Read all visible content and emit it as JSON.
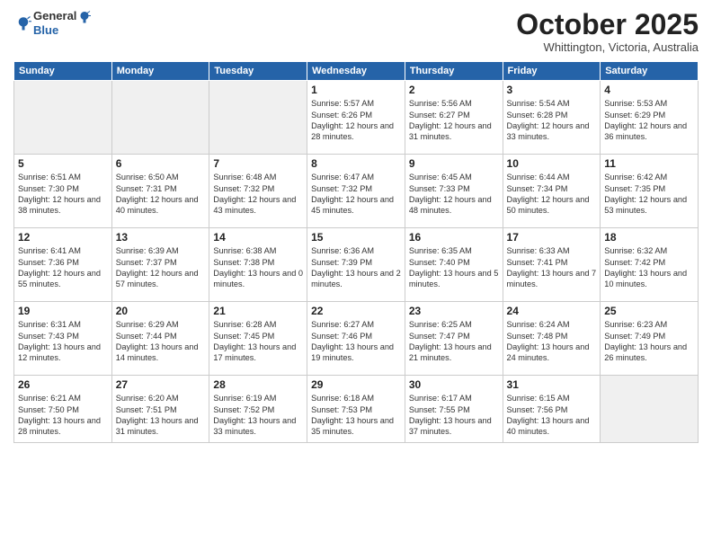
{
  "header": {
    "logo_general": "General",
    "logo_blue": "Blue",
    "month_title": "October 2025",
    "subtitle": "Whittington, Victoria, Australia"
  },
  "days_of_week": [
    "Sunday",
    "Monday",
    "Tuesday",
    "Wednesday",
    "Thursday",
    "Friday",
    "Saturday"
  ],
  "weeks": [
    [
      {
        "day": "",
        "info": ""
      },
      {
        "day": "",
        "info": ""
      },
      {
        "day": "",
        "info": ""
      },
      {
        "day": "1",
        "info": "Sunrise: 5:57 AM\nSunset: 6:26 PM\nDaylight: 12 hours\nand 28 minutes."
      },
      {
        "day": "2",
        "info": "Sunrise: 5:56 AM\nSunset: 6:27 PM\nDaylight: 12 hours\nand 31 minutes."
      },
      {
        "day": "3",
        "info": "Sunrise: 5:54 AM\nSunset: 6:28 PM\nDaylight: 12 hours\nand 33 minutes."
      },
      {
        "day": "4",
        "info": "Sunrise: 5:53 AM\nSunset: 6:29 PM\nDaylight: 12 hours\nand 36 minutes."
      }
    ],
    [
      {
        "day": "5",
        "info": "Sunrise: 6:51 AM\nSunset: 7:30 PM\nDaylight: 12 hours\nand 38 minutes."
      },
      {
        "day": "6",
        "info": "Sunrise: 6:50 AM\nSunset: 7:31 PM\nDaylight: 12 hours\nand 40 minutes."
      },
      {
        "day": "7",
        "info": "Sunrise: 6:48 AM\nSunset: 7:32 PM\nDaylight: 12 hours\nand 43 minutes."
      },
      {
        "day": "8",
        "info": "Sunrise: 6:47 AM\nSunset: 7:32 PM\nDaylight: 12 hours\nand 45 minutes."
      },
      {
        "day": "9",
        "info": "Sunrise: 6:45 AM\nSunset: 7:33 PM\nDaylight: 12 hours\nand 48 minutes."
      },
      {
        "day": "10",
        "info": "Sunrise: 6:44 AM\nSunset: 7:34 PM\nDaylight: 12 hours\nand 50 minutes."
      },
      {
        "day": "11",
        "info": "Sunrise: 6:42 AM\nSunset: 7:35 PM\nDaylight: 12 hours\nand 53 minutes."
      }
    ],
    [
      {
        "day": "12",
        "info": "Sunrise: 6:41 AM\nSunset: 7:36 PM\nDaylight: 12 hours\nand 55 minutes."
      },
      {
        "day": "13",
        "info": "Sunrise: 6:39 AM\nSunset: 7:37 PM\nDaylight: 12 hours\nand 57 minutes."
      },
      {
        "day": "14",
        "info": "Sunrise: 6:38 AM\nSunset: 7:38 PM\nDaylight: 13 hours\nand 0 minutes."
      },
      {
        "day": "15",
        "info": "Sunrise: 6:36 AM\nSunset: 7:39 PM\nDaylight: 13 hours\nand 2 minutes."
      },
      {
        "day": "16",
        "info": "Sunrise: 6:35 AM\nSunset: 7:40 PM\nDaylight: 13 hours\nand 5 minutes."
      },
      {
        "day": "17",
        "info": "Sunrise: 6:33 AM\nSunset: 7:41 PM\nDaylight: 13 hours\nand 7 minutes."
      },
      {
        "day": "18",
        "info": "Sunrise: 6:32 AM\nSunset: 7:42 PM\nDaylight: 13 hours\nand 10 minutes."
      }
    ],
    [
      {
        "day": "19",
        "info": "Sunrise: 6:31 AM\nSunset: 7:43 PM\nDaylight: 13 hours\nand 12 minutes."
      },
      {
        "day": "20",
        "info": "Sunrise: 6:29 AM\nSunset: 7:44 PM\nDaylight: 13 hours\nand 14 minutes."
      },
      {
        "day": "21",
        "info": "Sunrise: 6:28 AM\nSunset: 7:45 PM\nDaylight: 13 hours\nand 17 minutes."
      },
      {
        "day": "22",
        "info": "Sunrise: 6:27 AM\nSunset: 7:46 PM\nDaylight: 13 hours\nand 19 minutes."
      },
      {
        "day": "23",
        "info": "Sunrise: 6:25 AM\nSunset: 7:47 PM\nDaylight: 13 hours\nand 21 minutes."
      },
      {
        "day": "24",
        "info": "Sunrise: 6:24 AM\nSunset: 7:48 PM\nDaylight: 13 hours\nand 24 minutes."
      },
      {
        "day": "25",
        "info": "Sunrise: 6:23 AM\nSunset: 7:49 PM\nDaylight: 13 hours\nand 26 minutes."
      }
    ],
    [
      {
        "day": "26",
        "info": "Sunrise: 6:21 AM\nSunset: 7:50 PM\nDaylight: 13 hours\nand 28 minutes."
      },
      {
        "day": "27",
        "info": "Sunrise: 6:20 AM\nSunset: 7:51 PM\nDaylight: 13 hours\nand 31 minutes."
      },
      {
        "day": "28",
        "info": "Sunrise: 6:19 AM\nSunset: 7:52 PM\nDaylight: 13 hours\nand 33 minutes."
      },
      {
        "day": "29",
        "info": "Sunrise: 6:18 AM\nSunset: 7:53 PM\nDaylight: 13 hours\nand 35 minutes."
      },
      {
        "day": "30",
        "info": "Sunrise: 6:17 AM\nSunset: 7:55 PM\nDaylight: 13 hours\nand 37 minutes."
      },
      {
        "day": "31",
        "info": "Sunrise: 6:15 AM\nSunset: 7:56 PM\nDaylight: 13 hours\nand 40 minutes."
      },
      {
        "day": "",
        "info": ""
      }
    ]
  ]
}
